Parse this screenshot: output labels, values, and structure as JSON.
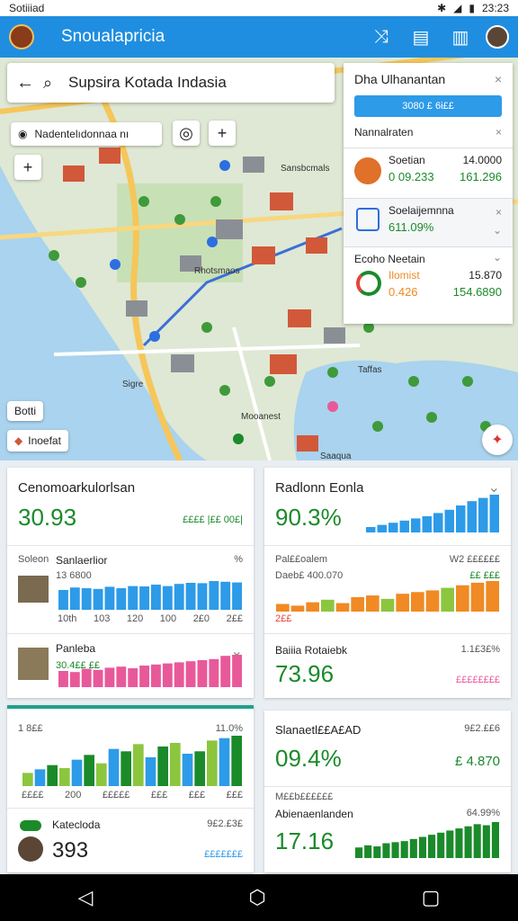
{
  "status": {
    "left": "Sotiiiad",
    "time": "23:23"
  },
  "app": {
    "title": "Snoualapricia"
  },
  "search": {
    "text": "Supsira Kotada Indasia"
  },
  "map": {
    "chip_label": "Nadentelıdonnaa nı",
    "zoom_in": "+",
    "add": "+",
    "bottom_chip1": "Botti",
    "bottom_chip2": "Inoefat",
    "labels": [
      "Sansbcmals",
      "Rhotsmaos",
      "Sigre",
      "Mooanest",
      "Taffas",
      "Saaqua"
    ]
  },
  "panel": {
    "title": "Dha Ulhanantan",
    "bar_text": "3080 £ 6i££",
    "subtitle": "Nannalraten",
    "item1_name": "Soetian",
    "item1_v1": "14.0000",
    "item1_a": "0 09.233",
    "item1_b": "161.296",
    "item2_name": "Soelaijemnna",
    "item2_a": "611.09%",
    "sec3_title": "Ecoho Neetain",
    "item3_name": "Ilomist",
    "item3_v1": "15.870",
    "item3_a": "0.426",
    "item3_b": "154.6890"
  },
  "card1": {
    "title": "Cenomoarkulorlsan",
    "value": "30.93",
    "side": "££££ |££ 00£|",
    "sub_left": "Soleon",
    "sub_name": "Sanlaerlior",
    "sub_value": "13 6800",
    "sub_pct": "%",
    "x_labels": [
      "10th",
      "103",
      "120",
      "100",
      "2£0",
      "2££"
    ],
    "item2_name": "Panleba",
    "item2_value": "30.4££ ££"
  },
  "card2": {
    "title": "Radlonn Eonla",
    "value": "90.3%",
    "row1_left": "Pal££oalem",
    "row1_right": "W2 ££££££",
    "row2_left": "Daeb£ 400.070",
    "row2_right": "££ £££",
    "axis": "2££",
    "kpi_title": "Baiiia Rotaiebk",
    "kpi_pct": "1.1£3£%",
    "kpi_value": "73.96",
    "kpi_note": "££££££££"
  },
  "card3": {
    "ylabel": "1 8££",
    "yright": "11.0%",
    "x_labels": [
      "££££",
      "200",
      "£££££",
      "£££",
      "£££",
      "£££"
    ],
    "name": "Katecloda",
    "right": "9£2.£3£",
    "value": "393",
    "note": "£££££££"
  },
  "card4": {
    "title": "Slanaetl££A£AD",
    "right": "9£2.££6",
    "value": "09.4%",
    "sub": "£ 4.870",
    "mid": "M££b££££££",
    "name": "Abienaenlanden",
    "pct": "64.99%",
    "value2": "17.16"
  },
  "colors": {
    "blue": "#2d9be8",
    "green": "#1a8a2a",
    "orange": "#f08a24",
    "pink": "#e8599a",
    "lime": "#8cc63f"
  },
  "bars": {
    "card1_blue": [
      55,
      62,
      60,
      58,
      64,
      60,
      66,
      65,
      70,
      66,
      72,
      75,
      74,
      80,
      78,
      76
    ],
    "card1_pink": [
      30,
      28,
      34,
      32,
      36,
      38,
      35,
      40,
      42,
      44,
      46,
      48,
      50,
      52,
      58,
      60
    ],
    "card2_blue": [
      10,
      14,
      18,
      22,
      26,
      30,
      36,
      42,
      50,
      58,
      64,
      70
    ],
    "card2_mix": [
      18,
      14,
      22,
      28,
      20,
      34,
      38,
      30,
      42,
      46,
      50,
      56,
      62,
      68,
      72
    ],
    "card3_mix": [
      22,
      28,
      35,
      30,
      44,
      52,
      38,
      62,
      58,
      70,
      48,
      66,
      72,
      54,
      58,
      76,
      80,
      84
    ],
    "card4_green": [
      20,
      24,
      22,
      28,
      30,
      32,
      36,
      40,
      44,
      48,
      52,
      56,
      60,
      64,
      62,
      68
    ]
  }
}
